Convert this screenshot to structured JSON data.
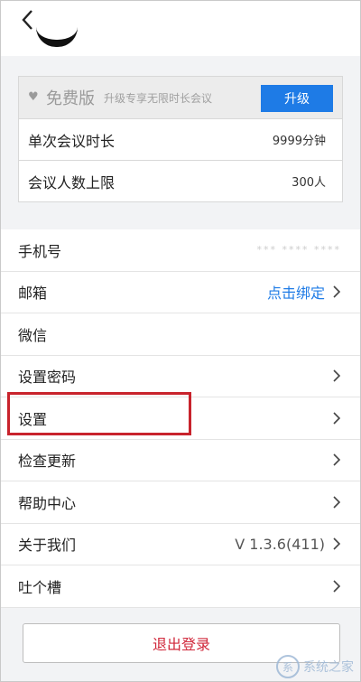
{
  "header": {
    "back_icon": "chevron-left-icon"
  },
  "plan": {
    "badge_icon": "heart-icon",
    "edition": "免费版",
    "subtitle": "升级专享无限时长会议",
    "upgrade_label": "升级",
    "rows": [
      {
        "label": "单次会议时长",
        "value": "9999分钟"
      },
      {
        "label": "会议人数上限",
        "value": "300人"
      }
    ]
  },
  "menu": {
    "phone": {
      "label": "手机号",
      "value": "*** **** ****"
    },
    "email": {
      "label": "邮箱",
      "link": "点击绑定"
    },
    "wechat": {
      "label": "微信"
    },
    "password": {
      "label": "设置密码"
    },
    "settings": {
      "label": "设置"
    },
    "update": {
      "label": "检查更新"
    },
    "help": {
      "label": "帮助中心"
    },
    "about": {
      "label": "关于我们",
      "version": "V 1.3.6(411)"
    },
    "feedback": {
      "label": "吐个槽"
    }
  },
  "logout_label": "退出登录",
  "watermark": {
    "text": "系统之家",
    "logo": "系"
  },
  "colors": {
    "accent": "#1e7be6",
    "danger": "#d0273a",
    "highlight": "#c8232c"
  }
}
